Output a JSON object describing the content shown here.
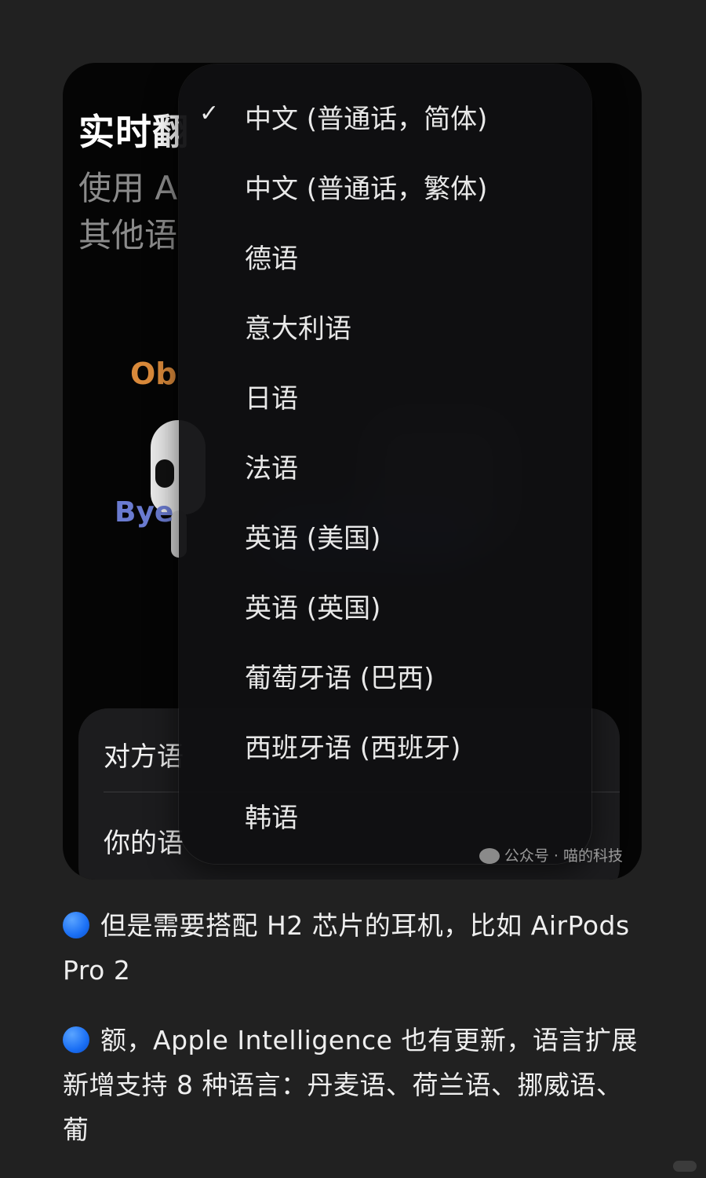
{
  "screenshot": {
    "background_title": "实时翻",
    "background_subtitle_line1": "使用 A",
    "background_subtitle_line2": "其他语",
    "bubble_text_1": "Ob",
    "bubble_text_2": "Bye",
    "settings_card": {
      "row1": "对方语",
      "row2": "你的语"
    },
    "language_menu": {
      "items": [
        {
          "label": "中文 (普通话，简体)",
          "selected": true,
          "check": "✓"
        },
        {
          "label": "中文 (普通话，繁体)",
          "selected": false,
          "check": ""
        },
        {
          "label": "德语",
          "selected": false,
          "check": ""
        },
        {
          "label": "意大利语",
          "selected": false,
          "check": ""
        },
        {
          "label": "日语",
          "selected": false,
          "check": ""
        },
        {
          "label": "法语",
          "selected": false,
          "check": ""
        },
        {
          "label": "英语 (美国)",
          "selected": false,
          "check": ""
        },
        {
          "label": "英语 (英国)",
          "selected": false,
          "check": ""
        },
        {
          "label": "葡萄牙语 (巴西)",
          "selected": false,
          "check": ""
        },
        {
          "label": "西班牙语 (西班牙)",
          "selected": false,
          "check": ""
        },
        {
          "label": "韩语",
          "selected": false,
          "check": ""
        }
      ]
    },
    "watermark": "公众号 · 喵的科技"
  },
  "article": {
    "paragraph1": "但是需要搭配 H2 芯片的耳机，比如 AirPods Pro 2",
    "paragraph2": "额，Apple Intelligence 也有更新，语言扩展新增支持 8 种语言：丹麦语、荷兰语、挪威语、葡",
    "bullet_color": "#1a6ff5"
  },
  "colors": {
    "page_background": "#212121",
    "accent_orange": "#d9893a",
    "accent_blue": "#6a7bd0"
  }
}
